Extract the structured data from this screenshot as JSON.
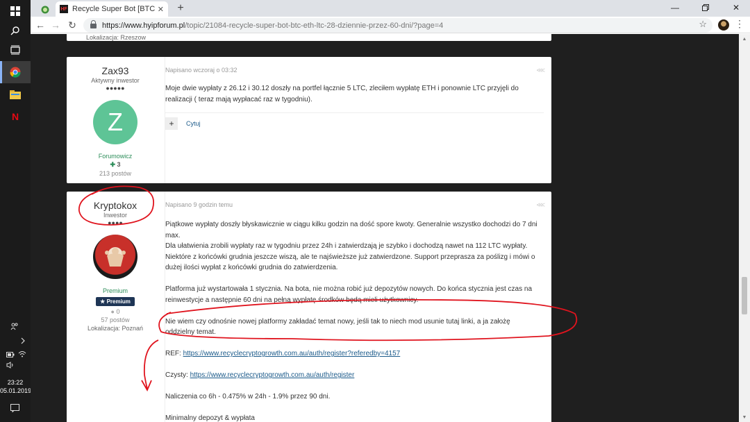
{
  "taskbar": {
    "time": "23:22",
    "date": "05.01.2019"
  },
  "browser": {
    "tab_title": "Recycle Super Bot [BTC, ETH, LTC]",
    "tab_favicon_text": "HF",
    "url_host": "https://www.hyipforum.pl",
    "url_path": "/topic/21084-recycle-super-bot-btc-eth-ltc-28-dziennie-przez-60-dni/?page=4"
  },
  "top_card": {
    "location": "Lokalizacja: Rzeszow"
  },
  "post1": {
    "username": "Zax93",
    "rank": "Aktywny inwestor",
    "pips": "●●●●●",
    "avatar_letter": "Z",
    "group": "Forumowicz",
    "reputation": "3",
    "posts": "213 postów",
    "meta": "Napisano wczoraj o 03:32",
    "body": "Moje dwie wypłaty z 26.12 i 30.12 doszły na portfel łącznie 5 LTC, zleciłem wypłatę ETH i ponownie LTC przyjęli do realizacji ( teraz mają wypłacać raz w tygodniu).",
    "quote_label": "Cytuj"
  },
  "post2": {
    "username": "Kryptokox",
    "rank": "Inwestor",
    "pips": "●●●●",
    "group": "Premium",
    "badge": "Premium",
    "reputation": "0",
    "posts": "57 postów",
    "location": "Lokalizacja: Poznań",
    "meta": "Napisano 9 godzin temu",
    "p1": "Piątkowe wypłaty doszły błyskawicznie w ciągu kilku godzin na dość spore kwoty. Generalnie wszystko dochodzi do 7 dni max.",
    "p1b": "Dla ułatwienia zrobili wypłaty raz w tygodniu przez 24h i zatwierdzają je szybko i dochodzą nawet na 112 LTC wypłaty. Niektóre z końcówki grudnia jeszcze wiszą, ale te najświeższe już zatwierdzone. Support przeprasza za poślizg i mówi o dużej ilości wypłat z końcówki grudnia do zatwierdzenia.",
    "p2": "Platforma już wystartowała 1 stycznia. Na bota, nie można robić już depozytów nowych. Do końca stycznia jest czas na reinwestycje a następnie 60 dni na pełną wypłatę środków będą mieli użytkownicy.",
    "p3": "Nie wiem czy odnośnie nowej platformy zakładać temat nowy, jeśli tak to niech mod usunie tutaj linki, a ja założę oddzielny temat.",
    "ref_label": "REF:",
    "ref_link": "https://www.recyclecryptogrowth.com.au/auth/register?referedby=4157",
    "clean_label": "Czysty:",
    "clean_link": "https://www.recyclecryptogrowth.com.au/auth/register",
    "p6": "Naliczenia co 6h - 0.475%  w 24h - 1.9% przez 90 dni.",
    "p7": "Minimalny depozyt & wypłata"
  },
  "colors": {
    "accent": "#1b5a8a",
    "green": "#2c8d59",
    "annotation": "#e0141e"
  }
}
